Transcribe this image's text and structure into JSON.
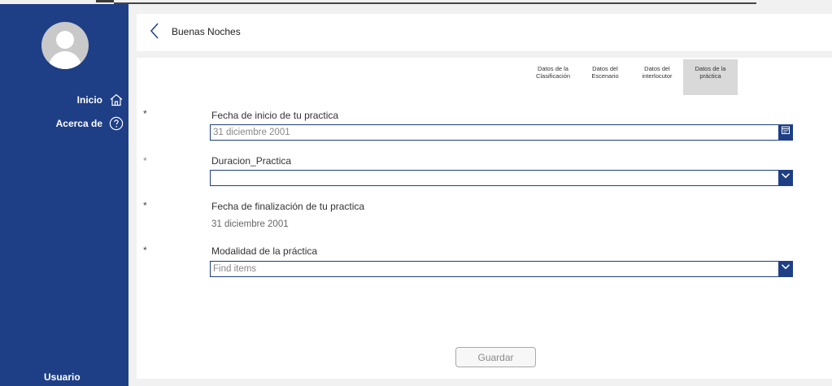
{
  "header": {
    "title": "Buenas Noches"
  },
  "sidebar": {
    "nav": [
      {
        "label": "Inicio",
        "icon": "home-icon"
      },
      {
        "label": "Acerca de",
        "icon": "help-circle-icon"
      }
    ],
    "user_label": "Usuario"
  },
  "tabs": [
    {
      "line1": "Datos de la",
      "line2": "Clasificación",
      "active": false
    },
    {
      "line1": "Datos del",
      "line2": "Escenario",
      "active": false
    },
    {
      "line1": "Datos del",
      "line2": "interlocutor",
      "active": false
    },
    {
      "line1": "Datos de la",
      "line2": "práctica",
      "active": true
    }
  ],
  "form": {
    "required_mark": "*",
    "fecha_inicio": {
      "label": "Fecha de inicio de tu practica",
      "value": "31 diciembre 2001",
      "icon": "calendar-icon"
    },
    "duracion": {
      "label": "Duracion_Practica",
      "value": "",
      "icon": "chevron-down-icon"
    },
    "fecha_fin": {
      "label": "Fecha de finalización de tu practica",
      "value": "31 diciembre 2001"
    },
    "modalidad": {
      "label": "Modalidad de la práctica",
      "placeholder": "Find items",
      "icon": "chevron-down-icon"
    },
    "save_label": "Guardar"
  },
  "colors": {
    "brand": "#1e3f86",
    "background": "#f1f1f1",
    "tab_active": "#d9d9d9"
  }
}
